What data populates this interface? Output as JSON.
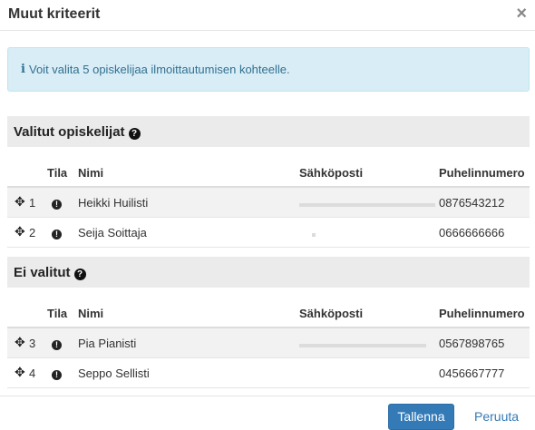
{
  "modal": {
    "title": "Muut kriteerit",
    "close_glyph": "×"
  },
  "info": {
    "icon": "i",
    "text": "Voit valita 5 opiskelijaa ilmoittautumisen kohteelle."
  },
  "table_headers": {
    "tila": "Tila",
    "nimi": "Nimi",
    "email": "Sähköposti",
    "phone": "Puhelinnumero"
  },
  "selected": {
    "title": "Valitut opiskelijat",
    "rows": [
      {
        "num": "1",
        "name": "Heikki Huilisti",
        "phone": "0876543212"
      },
      {
        "num": "2",
        "name": "Seija Soittaja",
        "phone": "0666666666"
      }
    ]
  },
  "not_selected": {
    "title": "Ei valitut",
    "rows": [
      {
        "num": "3",
        "name": "Pia Pianisti",
        "phone": "0567898765"
      },
      {
        "num": "4",
        "name": "Seppo Sellisti",
        "phone": "0456667777"
      }
    ]
  },
  "footer": {
    "save_label": "Tallenna",
    "cancel_label": "Peruuta"
  },
  "icons": {
    "move": "move-icon",
    "status": "exclamation-icon",
    "help": "question-icon",
    "info": "info-icon",
    "close": "close-icon"
  },
  "colors": {
    "primary": "#337ab7",
    "info_bg": "#d9edf7",
    "info_text": "#31708f",
    "section_bg": "#ebebeb"
  }
}
